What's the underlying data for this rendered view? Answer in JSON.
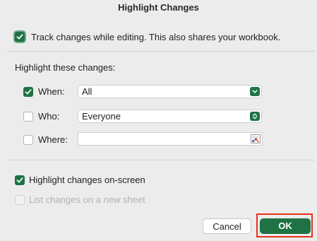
{
  "dialog": {
    "title": "Highlight Changes"
  },
  "track_changes": {
    "label": "Track changes while editing. This also shares your workbook.",
    "checked": true
  },
  "highlight_section": {
    "label": "Highlight these changes:"
  },
  "when": {
    "label": "When:",
    "checked": true,
    "value": "All"
  },
  "who": {
    "label": "Who:",
    "checked": false,
    "value": "Everyone"
  },
  "where": {
    "label": "Where:",
    "checked": false,
    "value": ""
  },
  "on_screen": {
    "label": "Highlight changes on-screen",
    "checked": true
  },
  "new_sheet": {
    "label": "List changes on a new sheet",
    "checked": false,
    "disabled": true
  },
  "buttons": {
    "cancel": "Cancel",
    "ok": "OK"
  },
  "colors": {
    "accent": "#1f7244",
    "highlight": "#e8321c"
  }
}
